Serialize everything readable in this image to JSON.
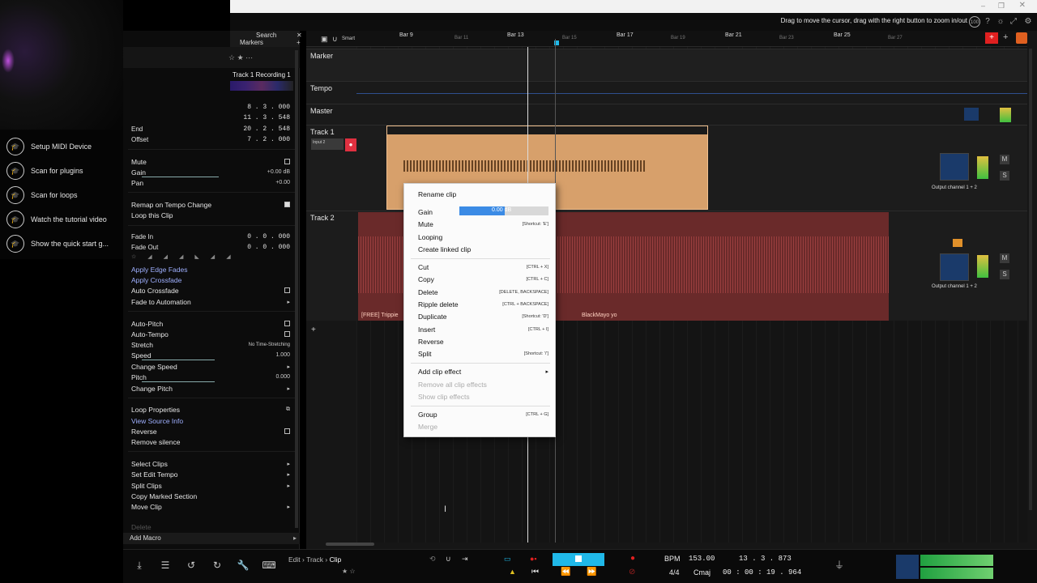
{
  "topbar": {
    "hint": "Drag to move the cursor, drag with the right button to zoom in/out",
    "zoom_badge": "100"
  },
  "quick_panel": {
    "items": [
      {
        "label": "Setup MIDI Device",
        "icon": "graduation-cap-icon"
      },
      {
        "label": "Scan for plugins",
        "icon": "graduation-cap-icon"
      },
      {
        "label": "Scan for loops",
        "icon": "graduation-cap-icon"
      },
      {
        "label": "Watch the tutorial video",
        "icon": "graduation-cap-icon"
      },
      {
        "label": "Show the quick start g...",
        "icon": "graduation-cap-icon"
      }
    ]
  },
  "inspector": {
    "tabs": {
      "search": "Search",
      "markers": "Markers"
    },
    "clip_title": "Track 1 Recording 1",
    "positions": [
      {
        "label": "",
        "value": "8 . 3 . 000"
      },
      {
        "label": "",
        "value": "11 . 3 . 548"
      },
      {
        "label": "End",
        "value": "20 . 2 . 548"
      },
      {
        "label": "Offset",
        "value": "7 . 2 . 000"
      }
    ],
    "mute": "Mute",
    "gain": {
      "label": "Gain",
      "value": "+0.00 dB"
    },
    "pan": {
      "label": "Pan",
      "value": "+0.00"
    },
    "remap": "Remap on Tempo Change",
    "loop": "Loop this Clip",
    "fade_in": {
      "label": "Fade In",
      "value": "0 . 0 . 000"
    },
    "fade_out": {
      "label": "Fade Out",
      "value": "0 . 0 . 000"
    },
    "apply_edge": "Apply Edge Fades",
    "apply_cross": "Apply Crossfade",
    "auto_cross": "Auto Crossfade",
    "fade_auto": "Fade to Automation",
    "auto_pitch": "Auto-Pitch",
    "auto_tempo": "Auto-Tempo",
    "stretch": {
      "label": "Stretch",
      "value": "No Time-Stretching"
    },
    "speed": {
      "label": "Speed",
      "value": "1.000"
    },
    "change_speed": "Change Speed",
    "pitch": {
      "label": "Pitch",
      "value": "0.000"
    },
    "change_pitch": "Change Pitch",
    "loop_props": "Loop Properties",
    "view_source": "View Source Info",
    "reverse": "Reverse",
    "remove_silence": "Remove silence",
    "select_clips": "Select Clips",
    "set_edit_tempo": "Set Edit Tempo",
    "split_clips": "Split Clips",
    "copy_marked": "Copy Marked Section",
    "move_clip": "Move Clip",
    "delete": "Delete",
    "add_macro": "Add Macro"
  },
  "ruler": {
    "smart": "Smart",
    "bars": [
      "Bar 9",
      "Bar 11",
      "Bar 13",
      "Bar 15",
      "Bar 17",
      "Bar 19",
      "Bar 21",
      "Bar 23",
      "Bar 25",
      "Bar 27"
    ]
  },
  "tracks": {
    "marker": "Marker",
    "tempo": "Tempo",
    "master": "Master",
    "track1": {
      "name": "Track 1",
      "input": "Input 2",
      "output": "Output channel 1 + 2"
    },
    "track2": {
      "name": "Track 2",
      "clip_left": "[FREE] Trippie",
      "clip_right": "BlackMayo yo",
      "output": "Output channel 1 + 2"
    },
    "mute_btn": "M",
    "solo_btn": "S"
  },
  "context_menu": {
    "rename": "Rename clip",
    "gain": "Gain",
    "gain_value": "0.00 dB",
    "mute": "Mute",
    "mute_sc": "[Shortcut: 'E']",
    "looping": "Looping",
    "linked": "Create linked clip",
    "cut": "Cut",
    "cut_sc": "[CTRL + X]",
    "copy": "Copy",
    "copy_sc": "[CTRL + C]",
    "delete": "Delete",
    "delete_sc": "[DELETE, BACKSPACE]",
    "ripple": "Ripple delete",
    "ripple_sc": "[CTRL + BACKSPACE]",
    "duplicate": "Duplicate",
    "duplicate_sc": "[Shortcut: 'D']",
    "insert": "Insert",
    "insert_sc": "[CTRL + I]",
    "reverse": "Reverse",
    "split": "Split",
    "split_sc": "[Shortcut: '/']",
    "add_effect": "Add clip effect",
    "remove_effects": "Remove all clip effects",
    "show_effects": "Show clip effects",
    "group": "Group",
    "group_sc": "[CTRL + G]",
    "merge": "Merge"
  },
  "transport": {
    "crumb_edit": "Edit",
    "crumb_track": "Track",
    "crumb_clip": "Clip",
    "bpm_label": "BPM",
    "bpm": "153.00",
    "position": "13 . 3 . 873",
    "time_sig": "4/4",
    "key": "Cmaj",
    "time": "00 : 00 : 19 . 964"
  },
  "colors": {
    "clip1": "#d7a06b",
    "clip2": "#6a2a2a",
    "accent": "#20b8e8",
    "record": "#e02020"
  }
}
